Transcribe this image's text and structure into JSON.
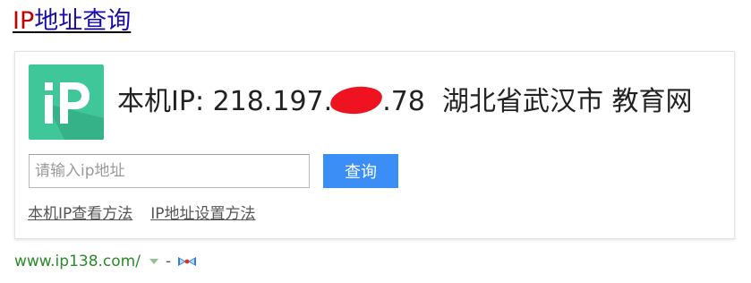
{
  "result_title": {
    "highlight": "IP",
    "rest": "地址查询"
  },
  "card": {
    "ip_label": "本机IP: 218.197.",
    "ip_suffix": ".78",
    "location": "湖北省武汉市 教育网",
    "input_placeholder": "请输入ip地址",
    "search_button": "查询",
    "links": [
      {
        "label": "本机IP查看方法"
      },
      {
        "label": "IP地址设置方法"
      }
    ]
  },
  "footer": {
    "url": "www.ip138.com/",
    "separator": "-"
  },
  "colors": {
    "title_highlight": "#c00000",
    "title_link": "#1a0dab",
    "button_bg": "#3a8ef6",
    "url_green": "#2a8a2a",
    "logo_green": "#3fc79a"
  }
}
